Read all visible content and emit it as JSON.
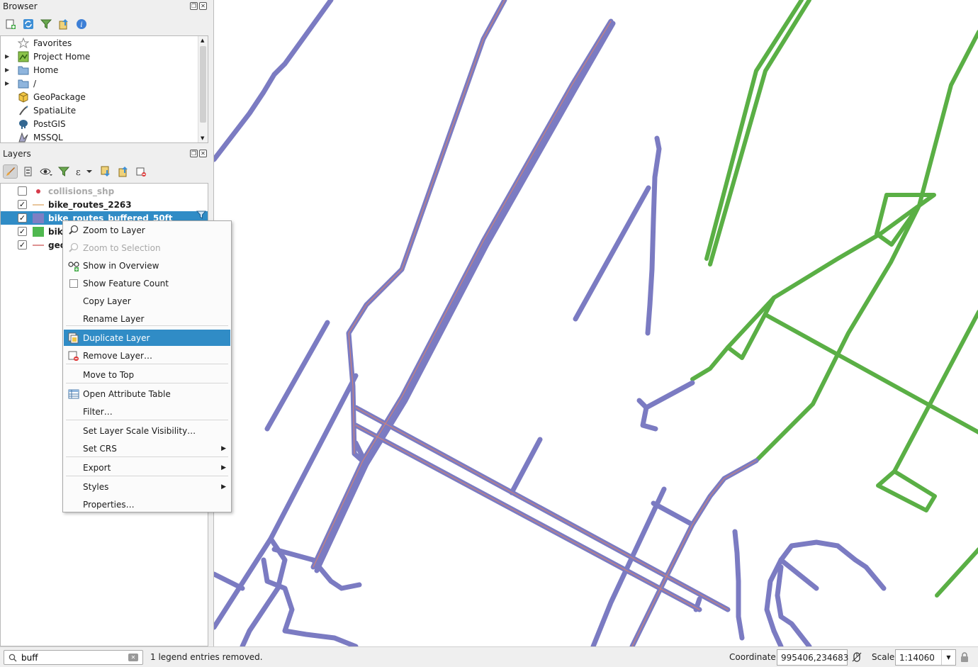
{
  "browser": {
    "title": "Browser",
    "items": [
      {
        "label": "Favorites",
        "icon": "star-icon",
        "expandable": false
      },
      {
        "label": "Project Home",
        "icon": "project-home-icon",
        "expandable": true
      },
      {
        "label": "Home",
        "icon": "folder-icon",
        "expandable": true
      },
      {
        "label": "/",
        "icon": "folder-icon",
        "expandable": true
      },
      {
        "label": "GeoPackage",
        "icon": "geopackage-icon",
        "expandable": false
      },
      {
        "label": "SpatiaLite",
        "icon": "spatialite-icon",
        "expandable": false
      },
      {
        "label": "PostGIS",
        "icon": "postgis-icon",
        "expandable": false
      },
      {
        "label": "MSSQL",
        "icon": "mssql-icon",
        "expandable": false
      }
    ]
  },
  "layers": {
    "title": "Layers",
    "items": [
      {
        "label": "collisions_shp",
        "checked": false,
        "symbol": "point",
        "color": "#d63b4a"
      },
      {
        "label": "bike_routes_2263",
        "checked": true,
        "symbol": "line",
        "color": "#d8a05a"
      },
      {
        "label": "bike_routes_buffered_50ft",
        "checked": true,
        "symbol": "fill",
        "color": "#7f7fc4"
      },
      {
        "label": "bike",
        "checked": true,
        "symbol": "fill",
        "color": "#4fb84f"
      },
      {
        "label": "geo",
        "checked": true,
        "symbol": "line",
        "color": "#c84a4a"
      }
    ]
  },
  "context_menu": {
    "items": [
      {
        "label": "Zoom to Layer",
        "icon": "zoom-to-layer-icon",
        "state": "normal"
      },
      {
        "label": "Zoom to Selection",
        "icon": "zoom-to-selection-icon",
        "state": "disabled"
      },
      {
        "label": "Show in Overview",
        "icon": "overview-icon",
        "state": "normal"
      },
      {
        "label": "Show Feature Count",
        "icon": "checkbox",
        "state": "normal"
      },
      {
        "label": "Copy Layer",
        "icon": "",
        "state": "normal"
      },
      {
        "label": "Rename Layer",
        "icon": "",
        "state": "normal"
      },
      {
        "label": "Duplicate Layer",
        "icon": "duplicate-layer-icon",
        "state": "highlight"
      },
      {
        "label": "Remove Layer…",
        "icon": "remove-layer-icon",
        "state": "normal"
      },
      {
        "label": "Move to Top",
        "icon": "",
        "state": "normal"
      },
      {
        "label": "Open Attribute Table",
        "icon": "attribute-table-icon",
        "state": "normal"
      },
      {
        "label": "Filter…",
        "icon": "",
        "state": "normal"
      },
      {
        "label": "Set Layer Scale Visibility…",
        "icon": "",
        "state": "normal"
      },
      {
        "label": "Set CRS",
        "icon": "",
        "state": "submenu"
      },
      {
        "label": "Export",
        "icon": "",
        "state": "submenu"
      },
      {
        "label": "Styles",
        "icon": "",
        "state": "submenu"
      },
      {
        "label": "Properties…",
        "icon": "",
        "state": "normal"
      }
    ]
  },
  "status": {
    "search_value": "buff",
    "message": "1 legend entries removed.",
    "coordinate_label": "Coordinate",
    "coordinate_value": "995406,234683",
    "scale_label": "Scale",
    "scale_value": "1:14060"
  },
  "map": {
    "route_color": "#7b7bc2",
    "route_center_color": "#d9826e",
    "green_color": "#5aaf45"
  }
}
